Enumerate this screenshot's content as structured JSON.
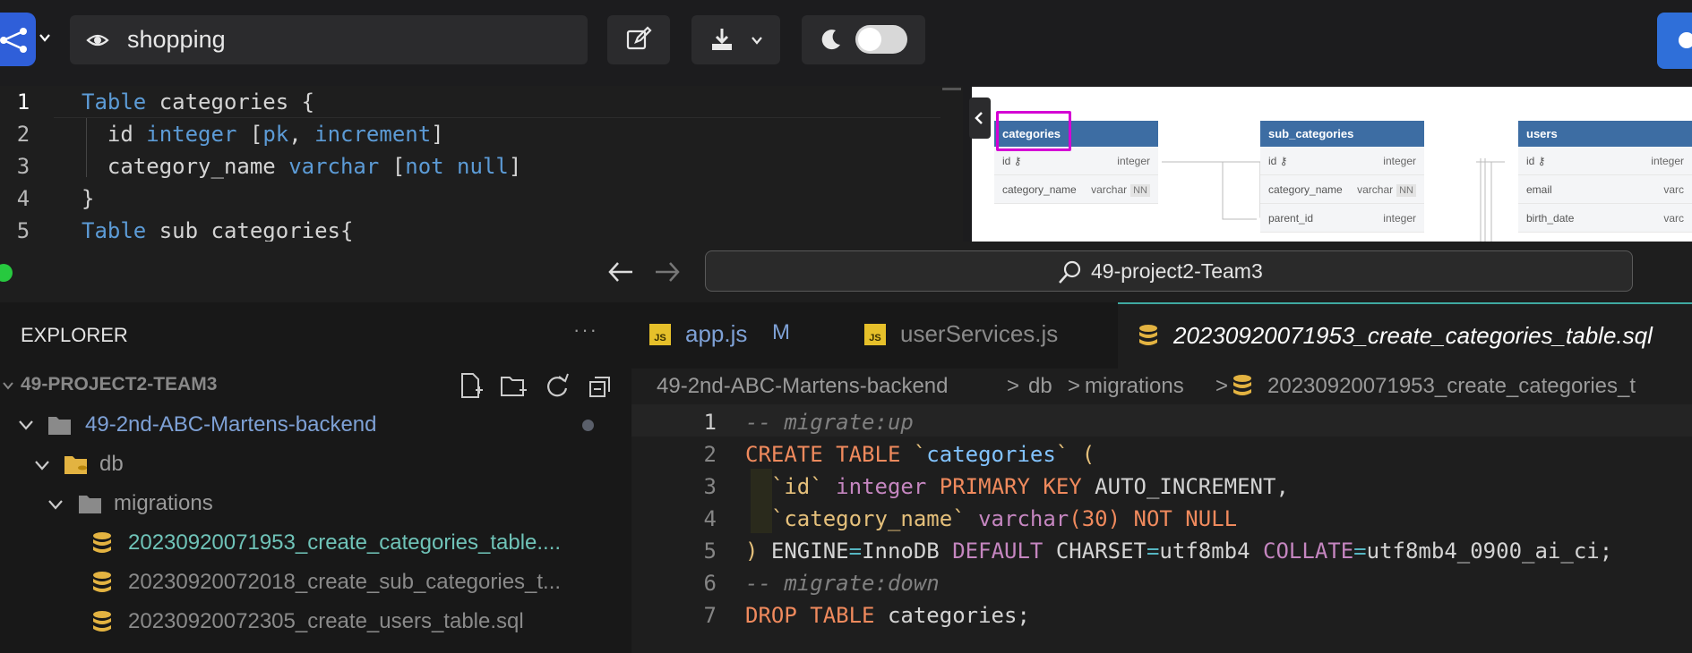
{
  "toolbar": {
    "diagram_name": "shopping"
  },
  "dbml_editor": {
    "line_numbers": [
      "1",
      "2",
      "3",
      "4",
      "5"
    ],
    "lines": {
      "l1_kw": "Table",
      "l1_rest": " categories {",
      "l2_a": "  id ",
      "l2_b": "integer",
      "l2_c": " [",
      "l2_d": "pk",
      "l2_e": ", ",
      "l2_f": "increment",
      "l2_g": "]",
      "l3_a": "  category_name ",
      "l3_b": "varchar",
      "l3_c": " [",
      "l3_d": "not null",
      "l3_e": "]",
      "l4": "}",
      "l5_kw": "Table",
      "l5_rest": " sub_categories{"
    }
  },
  "diagram": {
    "tables": [
      {
        "name": "categories",
        "rows": [
          {
            "name": "id",
            "type": "integer"
          },
          {
            "name": "category_name",
            "type": "varchar",
            "badge": "NN"
          }
        ]
      },
      {
        "name": "sub_categories",
        "rows": [
          {
            "name": "id",
            "type": "integer"
          },
          {
            "name": "category_name",
            "type": "varchar",
            "badge": "NN"
          },
          {
            "name": "parent_id",
            "type": "integer"
          }
        ]
      },
      {
        "name": "users",
        "rows": [
          {
            "name": "id",
            "type": "integer"
          },
          {
            "name": "email",
            "type": "varc"
          },
          {
            "name": "birth_date",
            "type": "varc"
          }
        ]
      }
    ]
  },
  "vscode": {
    "search_text": "49-project2-Team3",
    "explorer_title": "EXPLORER",
    "more": "···",
    "workspace": "49-PROJECT2-TEAM3",
    "tree": {
      "project": "49-2nd-ABC-Martens-backend",
      "db": "db",
      "migrations": "migrations",
      "file1": "20230920071953_create_categories_table....",
      "file2": "20230920072018_create_sub_categories_t...",
      "file3": "20230920072305_create_users_table.sql"
    },
    "tabs": {
      "t1": "app.js",
      "t1_badge": "M",
      "t2": "userServices.js",
      "t3": "20230920071953_create_categories_table.sql",
      "js_label": "JS"
    },
    "breadcrumb": {
      "b1": "49-2nd-ABC-Martens-backend",
      "b2": "db",
      "b3": "migrations",
      "b4": "20230920071953_create_categories_t",
      "sep": ">"
    },
    "code": {
      "line_numbers": [
        "1",
        "2",
        "3",
        "4",
        "5",
        "6",
        "7"
      ],
      "l1": "-- migrate:up",
      "l2_a": "CREATE TABLE ",
      "l2_b": "`",
      "l2_c": "categories",
      "l2_d": "`",
      "l2_e": " (",
      "l3_a": "  `",
      "l3_b": "id",
      "l3_c": "` ",
      "l3_d": "integer",
      "l3_e": " PRIMARY KEY",
      "l3_f": " AUTO_INCREMENT,",
      "l4_a": "  `",
      "l4_b": "category_name",
      "l4_c": "` ",
      "l4_d": "varchar",
      "l4_e": "(30)",
      "l4_f": " NOT NULL",
      "l5_a": ")",
      "l5_b": " ENGINE",
      "l5_c": "=",
      "l5_d": "InnoDB ",
      "l5_e": "DEFAULT",
      "l5_f": " CHARSET",
      "l5_g": "=",
      "l5_h": "utf8mb4 ",
      "l5_i": "COLLATE",
      "l5_j": "=",
      "l5_k": "utf8mb4_0900_ai_ci;",
      "l6": "-- migrate:down",
      "l7_a": "DROP TABLE",
      "l7_b": " categories;"
    }
  },
  "colors": {
    "accent": "#2f5fd9",
    "highlight": "#d400d4",
    "active_tab": "#3fa9a1"
  }
}
